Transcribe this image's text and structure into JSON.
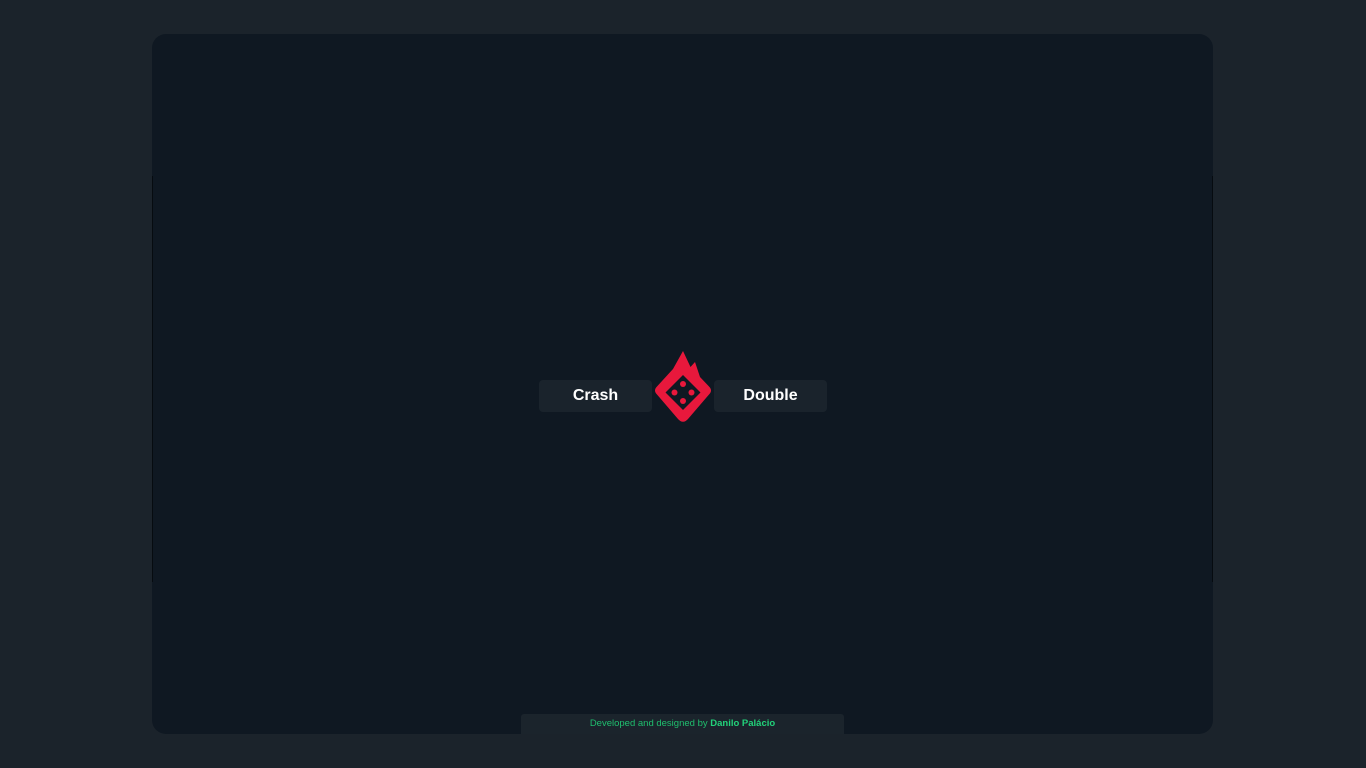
{
  "games": {
    "crash_label": "Crash",
    "double_label": "Double"
  },
  "logo": {
    "icon": "flaming-dice-icon",
    "color": "#e8183c"
  },
  "footer": {
    "prefix": "Developed and designed by",
    "author": "Danilo Palácio",
    "color": "#1fbf6e"
  },
  "colors": {
    "background": "#1b232b",
    "panel": "#0f1822",
    "button": "#1a232c"
  }
}
